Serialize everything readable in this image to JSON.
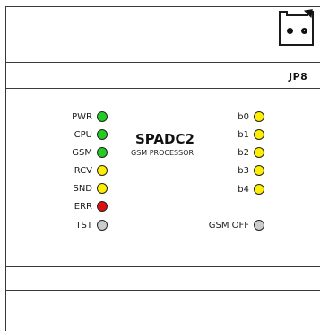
{
  "board": {
    "name": "SPADC2",
    "subtitle": "GSM PROCESSOR",
    "connector_label": "JP8"
  },
  "colors": {
    "green": "#22cc22",
    "yellow": "#ffee00",
    "red": "#dd1111",
    "gray": "#cccccc"
  },
  "left_leds": [
    {
      "label": "PWR",
      "color": "#22cc22"
    },
    {
      "label": "CPU",
      "color": "#22cc22"
    },
    {
      "label": "GSM",
      "color": "#22cc22"
    },
    {
      "label": "RCV",
      "color": "#ffee00"
    },
    {
      "label": "SND",
      "color": "#ffee00"
    },
    {
      "label": "ERR",
      "color": "#dd1111"
    },
    {
      "label": "TST",
      "color": "#cccccc"
    }
  ],
  "right_leds": [
    {
      "label": "b0",
      "color": "#ffee00"
    },
    {
      "label": "b1",
      "color": "#ffee00"
    },
    {
      "label": "b2",
      "color": "#ffee00"
    },
    {
      "label": "b3",
      "color": "#ffee00"
    },
    {
      "label": "b4",
      "color": "#ffee00"
    }
  ],
  "gsm_off": {
    "label": "GSM OFF",
    "color": "#cccccc"
  }
}
